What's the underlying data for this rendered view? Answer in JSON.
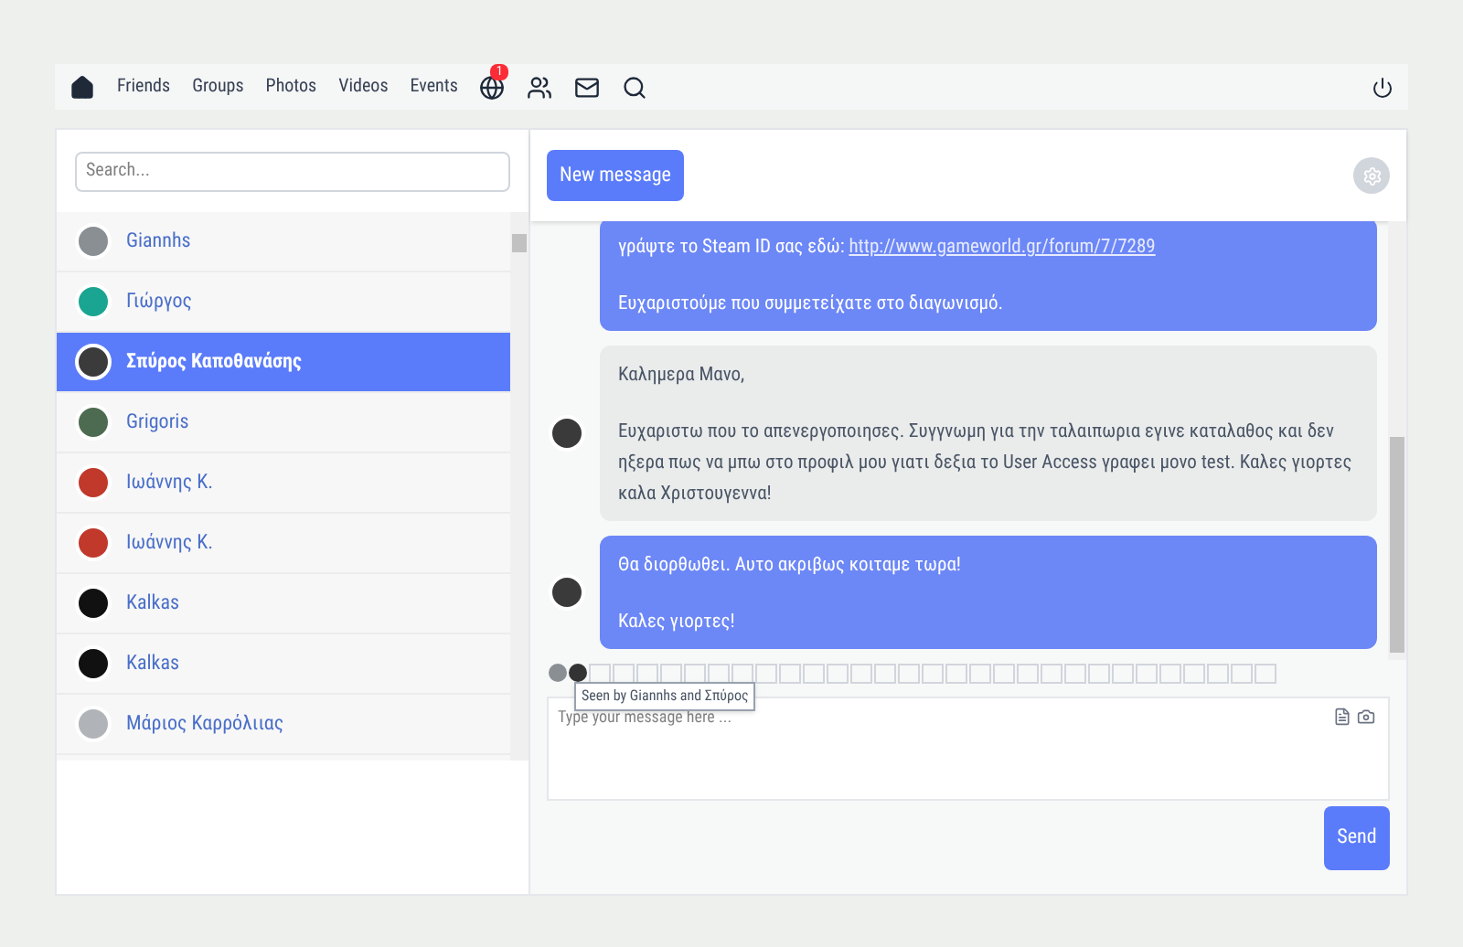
{
  "nav": {
    "items": [
      {
        "kind": "home"
      },
      {
        "kind": "text",
        "label": "Friends"
      },
      {
        "kind": "text",
        "label": "Groups"
      },
      {
        "kind": "text",
        "label": "Photos"
      },
      {
        "kind": "text",
        "label": "Videos"
      },
      {
        "kind": "text",
        "label": "Events"
      },
      {
        "kind": "globe",
        "badge": "1"
      },
      {
        "kind": "people"
      },
      {
        "kind": "mail"
      },
      {
        "kind": "search"
      }
    ]
  },
  "search": {
    "placeholder": "Search..."
  },
  "contacts": [
    {
      "name": "Giannhs",
      "selected": false
    },
    {
      "name": "Γιώργος",
      "selected": false
    },
    {
      "name": "Σπύρος Καποθανάσης",
      "selected": true
    },
    {
      "name": "Grigoris",
      "selected": false
    },
    {
      "name": "Ιωάννης Κ.",
      "selected": false
    },
    {
      "name": "Ιωάννης Κ.",
      "selected": false
    },
    {
      "name": "Kalkas",
      "selected": false
    },
    {
      "name": "Kalkas",
      "selected": false
    },
    {
      "name": "Μάριος Καρρόλιιας",
      "selected": false
    }
  ],
  "chat": {
    "new_message": "New message",
    "messages": [
      {
        "kind": "sent",
        "avatar": false,
        "paragraphs": [
          {
            "text": "γράψτε το Steam ID σας εδώ:",
            "link": "http://www.gameworld.gr/forum/7/7289"
          },
          {
            "text": "Ευχαριστούμε που συμμετείχατε στο διαγωνισμό."
          }
        ]
      },
      {
        "kind": "received",
        "avatar": true,
        "paragraphs": [
          {
            "text": "Καλημερα Μανο,"
          },
          {
            "text": "Ευχαριστω που το απενεργοποιησες. Συγγνωμη για την ταλαιπωρια εγινε καταλαθος και δεν ηξερα πως να μπω στο προφιλ μου γιατι δεξια το User Access γραφει μονο test. Καλες γιορτες καλα Χριστουγεννα!"
          }
        ]
      },
      {
        "kind": "sent",
        "avatar": true,
        "paragraphs": [
          {
            "text": "Θα διορθωθει. Αυτο ακριβως κοιταμε τωρα!"
          },
          {
            "text": "Καλες γιορτες!"
          }
        ]
      }
    ],
    "seen_tooltip": "Seen by Giannhs and Σπύρος",
    "composer": {
      "placeholder": "Type your message here ..."
    },
    "send": "Send"
  }
}
